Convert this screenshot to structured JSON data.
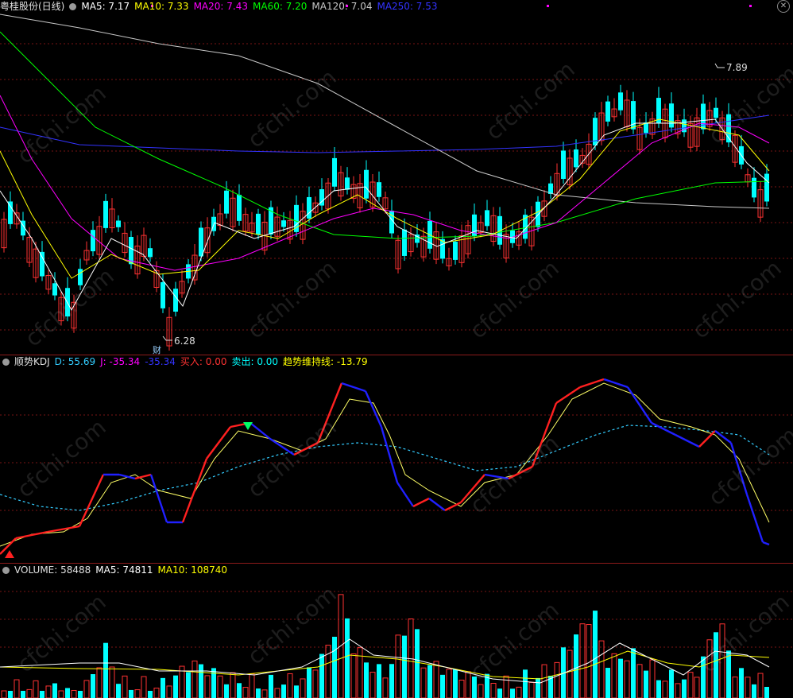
{
  "main": {
    "title": "粤桂股份(日线)",
    "ma5": "MA5: 7.17",
    "ma10": "MA10: 7.33",
    "ma20": "MA20: 7.43",
    "ma60": "MA60: 7.20",
    "ma120": "MA120: 7.04",
    "ma250": "MA250: 7.53",
    "high_label": "7.89",
    "low_label": "6.28",
    "cai_mark": "财",
    "colors": {
      "ma5": "#ffffff",
      "ma10": "#ffff00",
      "ma20": "#ff00ff",
      "ma60": "#00ff00",
      "ma120": "#c8c8c8",
      "ma250": "#3333ff",
      "up": "#ff3232",
      "down": "#00ffff"
    }
  },
  "kdj": {
    "title": "顺势KDJ",
    "d": "D: 55.69",
    "j": "J: -35.34",
    "k": "-35.34",
    "buy": "买入: 0.00",
    "sell": "卖出: 0.00",
    "trend": "趋势维持线: -13.79"
  },
  "volume": {
    "title": "VOLUME: 58488",
    "ma5": "MA5: 74811",
    "ma10": "MA10: 108740"
  },
  "watermark": "cfchi.com",
  "chart_data": {
    "type": "candlestick",
    "series": [
      {
        "name": "MA5",
        "value": 7.17
      },
      {
        "name": "MA10",
        "value": 7.33
      },
      {
        "name": "MA20",
        "value": 7.43
      },
      {
        "name": "MA60",
        "value": 7.2
      },
      {
        "name": "MA120",
        "value": 7.04
      },
      {
        "name": "MA250",
        "value": 7.53
      }
    ],
    "annotations": [
      "7.89",
      "6.28"
    ],
    "ylim": [
      6.1,
      8.2
    ]
  }
}
